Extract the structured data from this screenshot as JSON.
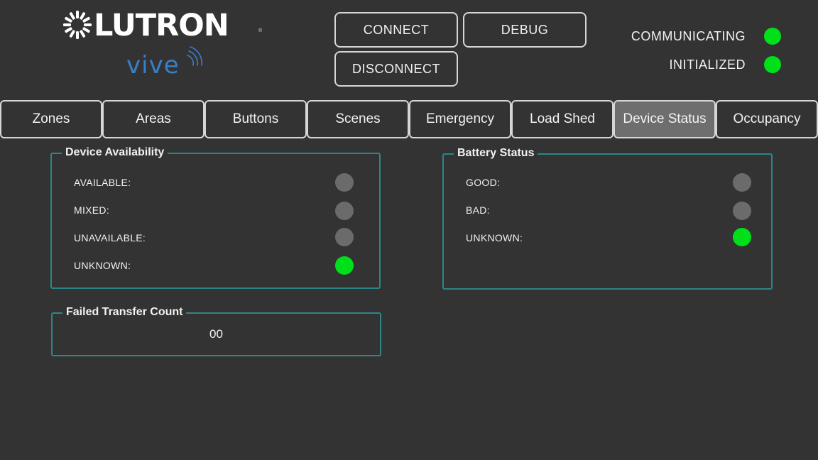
{
  "header": {
    "brand": "LUTRON",
    "registered_mark": "®",
    "product": "vive"
  },
  "controls": {
    "connect_label": "CONNECT",
    "debug_label": "DEBUG",
    "disconnect_label": "DISCONNECT"
  },
  "indicators": [
    {
      "label": "COMMUNICATING",
      "state": "on"
    },
    {
      "label": "INITIALIZED",
      "state": "on"
    }
  ],
  "tabs": [
    {
      "label": "Zones",
      "active": false
    },
    {
      "label": "Areas",
      "active": false
    },
    {
      "label": "Buttons",
      "active": false
    },
    {
      "label": "Scenes",
      "active": false
    },
    {
      "label": "Emergency",
      "active": false
    },
    {
      "label": "Load Shed",
      "active": false
    },
    {
      "label": "Device Status",
      "active": true
    },
    {
      "label": "Occupancy",
      "active": false
    }
  ],
  "device_availability": {
    "title": "Device Availability",
    "rows": [
      {
        "label": "AVAILABLE:",
        "state": "off"
      },
      {
        "label": "MIXED:",
        "state": "off"
      },
      {
        "label": "UNAVAILABLE:",
        "state": "off"
      },
      {
        "label": "UNKNOWN:",
        "state": "on"
      }
    ]
  },
  "battery_status": {
    "title": "Battery Status",
    "rows": [
      {
        "label": "GOOD:",
        "state": "off"
      },
      {
        "label": "BAD:",
        "state": "off"
      },
      {
        "label": "UNKNOWN:",
        "state": "on"
      }
    ]
  },
  "failed_transfer": {
    "title": "Failed Transfer Count",
    "value": "00"
  },
  "colors": {
    "background": "#333333",
    "led_on": "#00e01a",
    "led_off": "#6b6b6b",
    "group_border": "#2f8586",
    "active_tab": "#6e6e6e",
    "vive_blue": "#3a7fc6"
  }
}
